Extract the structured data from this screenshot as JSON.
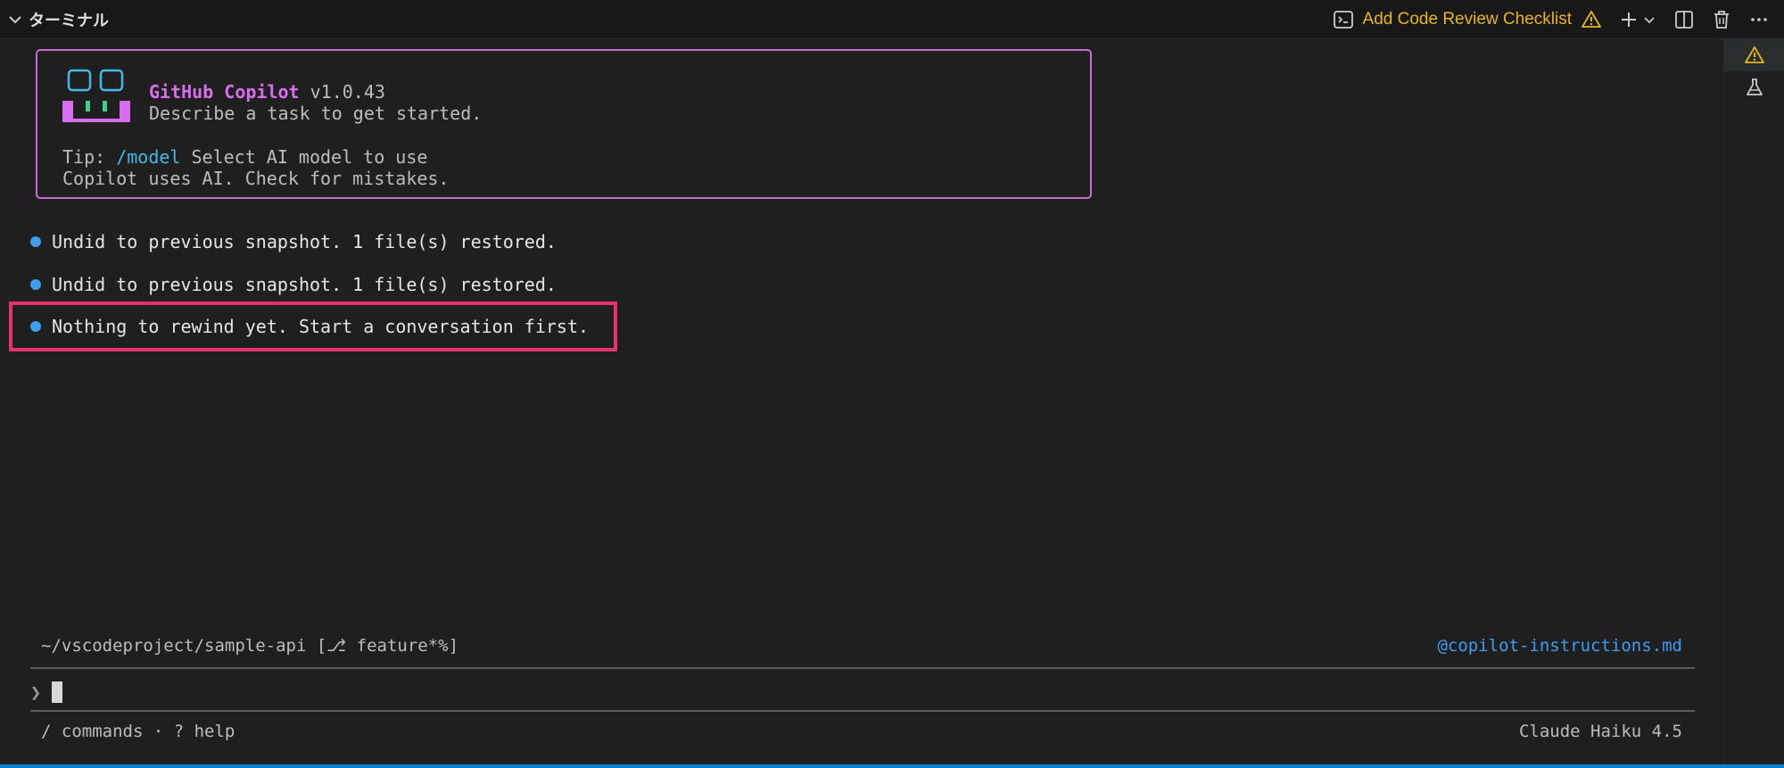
{
  "panel": {
    "title": "ターミナル",
    "task_label": "Add Code Review Checklist"
  },
  "banner": {
    "brand": "GitHub Copilot",
    "version": " v1.0.43",
    "subtitle": "Describe a task to get started.",
    "tip_prefix": "Tip: ",
    "tip_command": "/model",
    "tip_text": " Select AI model to use",
    "disclaimer": "Copilot uses AI. Check for mistakes."
  },
  "messages": [
    "Undid to previous snapshot. 1 file(s) restored.",
    "Undid to previous snapshot. 1 file(s) restored.",
    "Nothing to rewind yet. Start a conversation first."
  ],
  "status": {
    "path": "~/vscodeproject/sample-api [⎇ feature*%]",
    "instructions": "@copilot-instructions.md",
    "prompt_symbol": "❯",
    "help": "/ commands · ? help",
    "model": "Claude Haiku 4.5"
  },
  "colors": {
    "accent_brand": "#d76ef0",
    "highlight_border": "#e6336e",
    "bullet": "#3d9ef0",
    "warning": "#e8b51a"
  }
}
